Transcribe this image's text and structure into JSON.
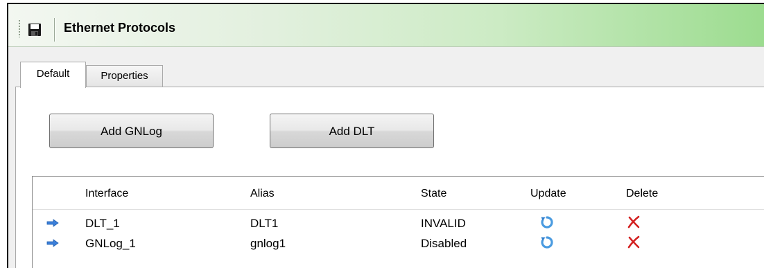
{
  "window": {
    "title": "Ethernet Protocols",
    "save_icon": "save-icon"
  },
  "tabs": [
    {
      "label": "Default",
      "active": true
    },
    {
      "label": "Properties",
      "active": false
    }
  ],
  "actions": {
    "add_gnlog_label": "Add GNLog",
    "add_dlt_label": "Add DLT"
  },
  "table": {
    "columns": [
      "Interface",
      "Alias",
      "State",
      "Update",
      "Delete"
    ],
    "rows": [
      {
        "indicator_icon": "arrow-right-icon",
        "interface": "DLT_1",
        "alias": "DLT1",
        "state": "INVALID",
        "update_icon": "refresh-icon",
        "delete_icon": "delete-icon"
      },
      {
        "indicator_icon": "arrow-right-icon",
        "interface": "GNLog_1",
        "alias": "gnlog1",
        "state": "Disabled",
        "update_icon": "refresh-icon",
        "delete_icon": "delete-icon"
      }
    ]
  },
  "colors": {
    "title_gradient_end": "#9cdc8f",
    "arrow_blue": "#3b7fd9",
    "refresh_blue": "#4a9be0",
    "delete_red": "#d32020"
  }
}
